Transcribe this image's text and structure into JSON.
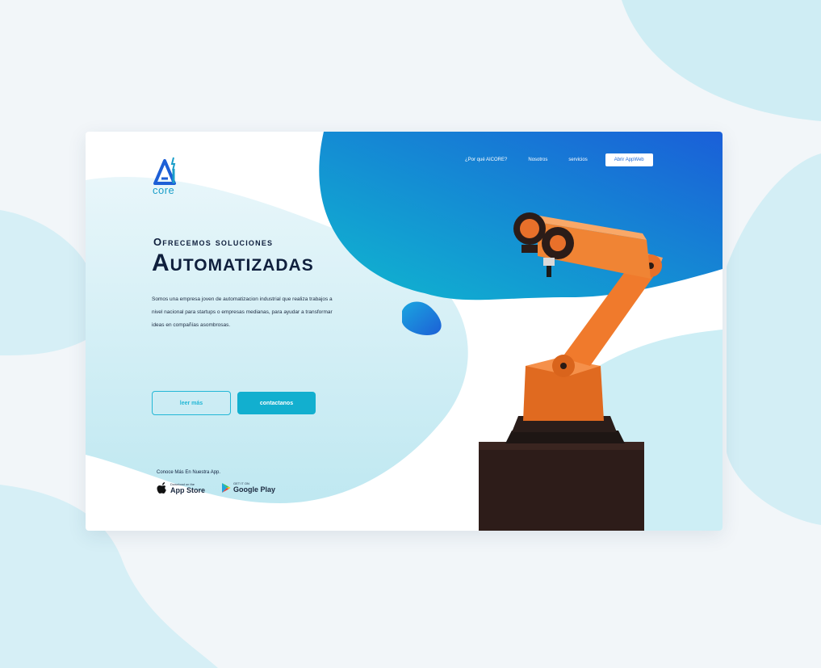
{
  "nav": {
    "links": [
      "¿Por qué AICORE?",
      "Nosotros",
      "servicios"
    ],
    "cta": "Abrir AppWeb"
  },
  "brand": {
    "name": "core"
  },
  "hero": {
    "eyebrow": "Ofrecemos soluciones",
    "title": "Automatizadas",
    "description": "Somos una empresa joven de automatizacion industrial que realiza trabajos a nivel nacional para startups o empresas medianas, para ayudar a transformar ideas en compañías asombrosas.",
    "btn_secondary": "leer más",
    "btn_primary": "contactanos"
  },
  "apps": {
    "caption": "Conoce Más En Nuestra App.",
    "apple": {
      "small": "Download on the",
      "big": "App Store"
    },
    "google": {
      "small": "GET IT ON",
      "big": "Google Play"
    }
  },
  "colors": {
    "accent": "#12afcf",
    "navy": "#0f1f3d",
    "gradient_start": "#0fb8cf",
    "gradient_end": "#1a5fd8",
    "robot": "#f08030"
  }
}
